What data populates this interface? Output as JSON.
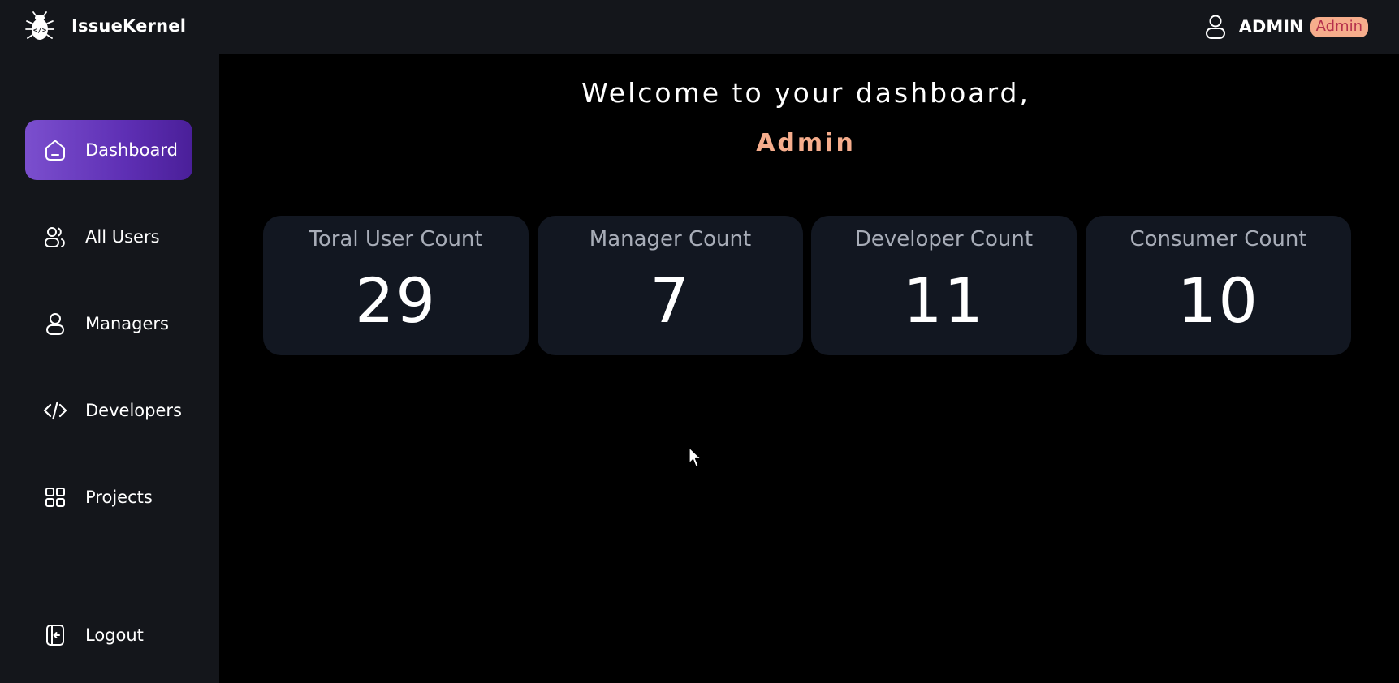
{
  "app": {
    "name": "IssueKernel",
    "logo_icon": "bug-icon"
  },
  "header": {
    "user_icon": "user-icon",
    "user_name": "ADMIN",
    "role_badge": "Admin",
    "badge_bg": "#f6ad8c",
    "badge_fg": "#b5304c"
  },
  "sidebar": {
    "items": [
      {
        "label": "Dashboard",
        "icon": "home-icon",
        "active": true
      },
      {
        "label": "All Users",
        "icon": "users-icon",
        "active": false
      },
      {
        "label": "Managers",
        "icon": "user-icon",
        "active": false
      },
      {
        "label": "Developers",
        "icon": "code-icon",
        "active": false
      },
      {
        "label": "Projects",
        "icon": "grid-icon",
        "active": false
      }
    ],
    "logout": {
      "label": "Logout",
      "icon": "logout-icon"
    }
  },
  "main": {
    "welcome": "Welcome to your dashboard,",
    "name": "Admin",
    "cards": [
      {
        "title": "Toral User Count",
        "value": "29"
      },
      {
        "title": "Manager Count",
        "value": "7"
      },
      {
        "title": "Developer Count",
        "value": "11"
      },
      {
        "title": "Consumer Count",
        "value": "10"
      }
    ]
  },
  "colors": {
    "accent_gradient_start": "#7b4fce",
    "accent_gradient_end": "#4a1f99",
    "highlight": "#f6ad8c",
    "card_bg": "#121721",
    "panel_bg": "#14161b",
    "background": "#000000"
  }
}
